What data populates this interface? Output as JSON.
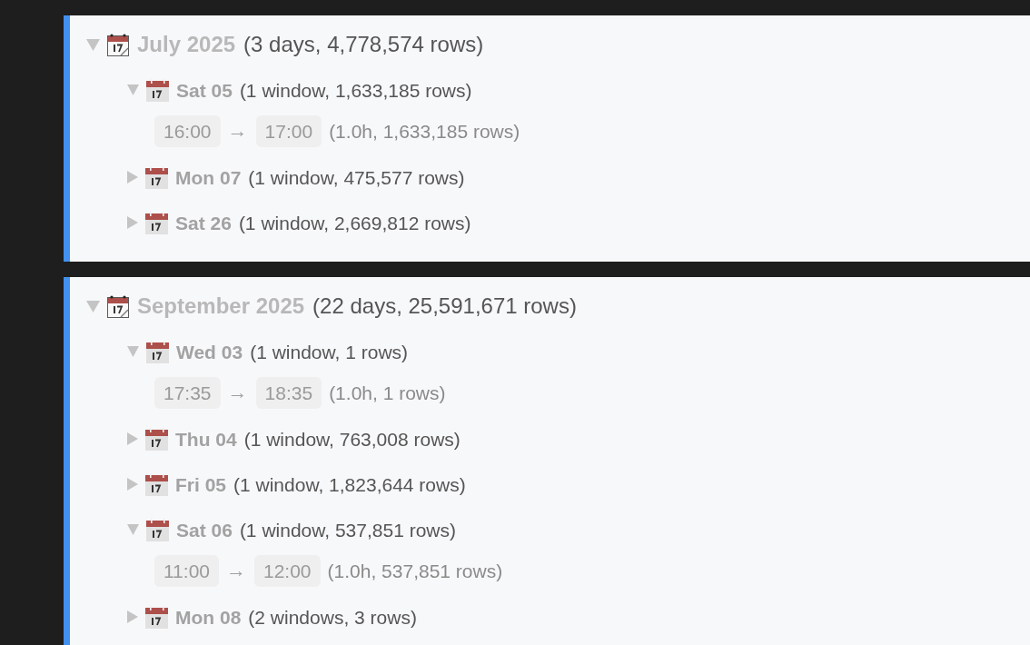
{
  "months": [
    {
      "label": "July 2025",
      "summary": "(3 days, 4,778,574 rows)",
      "expanded": true,
      "children": [
        {
          "label": "Sat 05",
          "summary": "(1 window, 1,633,185 rows)",
          "expanded": true,
          "children": [
            {
              "start": "16:00",
              "arrow": "→",
              "end": "17:00",
              "summary": "(1.0h, 1,633,185 rows)"
            }
          ]
        },
        {
          "label": "Mon 07",
          "summary": "(1 window, 475,577 rows)",
          "expanded": false
        },
        {
          "label": "Sat 26",
          "summary": "(1 window, 2,669,812 rows)",
          "expanded": false
        }
      ]
    },
    {
      "label": "September 2025",
      "summary": "(22 days, 25,591,671 rows)",
      "expanded": true,
      "children": [
        {
          "label": "Wed 03",
          "summary": "(1 window, 1 rows)",
          "expanded": true,
          "children": [
            {
              "start": "17:35",
              "arrow": "→",
              "end": "18:35",
              "summary": "(1.0h, 1 rows)"
            }
          ]
        },
        {
          "label": "Thu 04",
          "summary": "(1 window, 763,008 rows)",
          "expanded": false
        },
        {
          "label": "Fri 05",
          "summary": "(1 window, 1,823,644 rows)",
          "expanded": false
        },
        {
          "label": "Sat 06",
          "summary": "(1 window, 537,851 rows)",
          "expanded": true,
          "children": [
            {
              "start": "11:00",
              "arrow": "→",
              "end": "12:00",
              "summary": "(1.0h, 537,851 rows)"
            }
          ]
        },
        {
          "label": "Mon 08",
          "summary": "(2 windows, 3 rows)",
          "expanded": false
        }
      ]
    }
  ]
}
